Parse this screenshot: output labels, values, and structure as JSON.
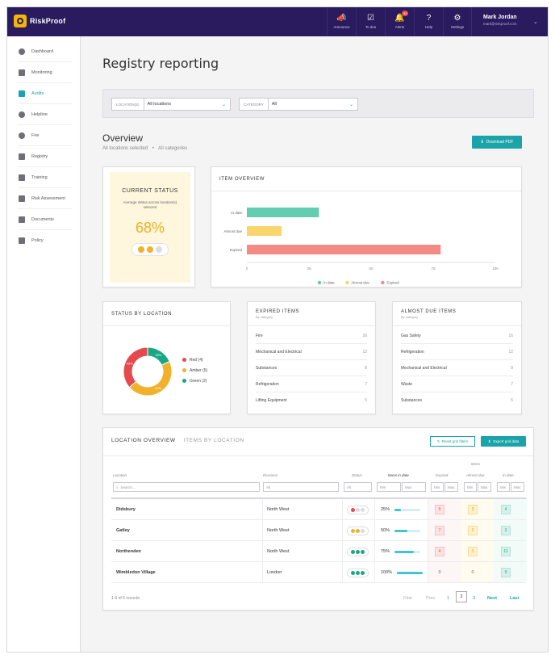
{
  "app": {
    "brand": "RiskProof",
    "colors": {
      "topbar": "#2a1a5e",
      "accent": "#1aa3a8",
      "red": "#e5484d",
      "amber": "#f2b12a",
      "green": "#19a886"
    }
  },
  "topnav": [
    {
      "label": "Announce",
      "icon": "megaphone-icon"
    },
    {
      "label": "To dos",
      "icon": "checkbox-icon"
    },
    {
      "label": "Alerts",
      "icon": "bell-icon",
      "badge": "99"
    },
    {
      "label": "Help",
      "icon": "help-icon"
    },
    {
      "label": "Settings",
      "icon": "gear-icon"
    }
  ],
  "user": {
    "name": "Mark Jordan",
    "email": "mark@riskproof.com"
  },
  "sidebar": [
    {
      "label": "Dashboard"
    },
    {
      "label": "Monitoring"
    },
    {
      "label": "Audits",
      "active": true
    },
    {
      "label": "Helpline"
    },
    {
      "label": "Fire"
    },
    {
      "label": "Registry"
    },
    {
      "label": "Training"
    },
    {
      "label": "Risk Assessment"
    },
    {
      "label": "Documents"
    },
    {
      "label": "Policy"
    }
  ],
  "page": {
    "title": "Registry reporting"
  },
  "filters": {
    "location_tag": "LOCATION(S)",
    "location_value": "All locations",
    "category_tag": "CATEGORY",
    "category_value": "All"
  },
  "overview": {
    "title": "Overview",
    "selected_locations": "All locations selected",
    "separator": "•",
    "selected_categories": "All categories",
    "download_label": "Download PDF"
  },
  "current_status": {
    "title": "CURRENT STATUS",
    "description": "Average status across location(s) selected",
    "percent": "68%",
    "dots": [
      "#f2b12a",
      "#f2b12a",
      "#dcdce0"
    ]
  },
  "item_overview": {
    "title": "ITEM OVERVIEW",
    "chart_data": {
      "type": "bar",
      "orientation": "horizontal",
      "categories": [
        "In date",
        "Almost due",
        "Expired"
      ],
      "values": [
        29,
        14,
        78
      ],
      "colors": [
        "#62cdb0",
        "#f9d56b",
        "#f38a84"
      ],
      "xlim": [
        0,
        100
      ],
      "xticks": [
        "0",
        "25",
        "50",
        "75",
        "100"
      ],
      "legend": [
        "In date",
        "Almost due",
        "Expired"
      ],
      "legend_position": "bottom"
    }
  },
  "status_by_location": {
    "title": "STATUS BY LOCATION",
    "chart_data": {
      "type": "pie",
      "donut": true,
      "labels": [
        "Red",
        "Amber",
        "Green"
      ],
      "values": [
        4,
        5,
        2
      ],
      "slice_labels": [
        "43%",
        "40%",
        "16%"
      ],
      "colors": [
        "#e5484d",
        "#f2b12a",
        "#19a886"
      ],
      "legend_position": "right"
    },
    "legend": [
      "Red (4)",
      "Amber (5)",
      "Green (2)"
    ]
  },
  "expired_items": {
    "title": "EXPIRED ITEMS",
    "subtitle": "By category",
    "rows": [
      {
        "name": "Fire",
        "count": "16"
      },
      {
        "name": "Mechanical and Electrical",
        "count": "12"
      },
      {
        "name": "Substances",
        "count": "8"
      },
      {
        "name": "Refrigeration",
        "count": "7"
      },
      {
        "name": "Lifting Equipment",
        "count": "5"
      }
    ]
  },
  "almost_due_items": {
    "title": "ALMOST DUE ITEMS",
    "subtitle": "By category",
    "rows": [
      {
        "name": "Gas Safety",
        "count": "16"
      },
      {
        "name": "Refrigeration",
        "count": "12"
      },
      {
        "name": "Mechanical and Electrical",
        "count": "8"
      },
      {
        "name": "Waste",
        "count": "7"
      },
      {
        "name": "Substances",
        "count": "5"
      }
    ]
  },
  "location_table": {
    "tab_active": "LOCATION OVERVIEW",
    "tab_inactive": "ITEMS BY LOCATION",
    "reset_label": "Reset grid filters",
    "export_label": "Export grid data",
    "headers": {
      "location": "Location",
      "divisions": "Divisions",
      "status": "Status",
      "in_date_pct": "Items in date",
      "items_group": "Items",
      "expired": "Expired",
      "almost_due": "Almost due",
      "in_date": "In date"
    },
    "filters": {
      "search_placeholder": "Search...",
      "divisions": "All",
      "status": "All",
      "min": "Min",
      "max": "Max"
    },
    "rows": [
      {
        "location": "Didsbury",
        "division": "North West",
        "dots": [
          "#e5484d",
          "#dcdce0",
          "#dcdce0"
        ],
        "pct_label": "25%",
        "pct": 0.25,
        "expired": "9",
        "almost_due": "3",
        "in_date": "4"
      },
      {
        "location": "Gatley",
        "division": "North West",
        "dots": [
          "#f2b12a",
          "#f2b12a",
          "#dcdce0"
        ],
        "pct_label": "50%",
        "pct": 0.5,
        "expired": "7",
        "almost_due": "2",
        "in_date": "3"
      },
      {
        "location": "Northenden",
        "division": "North West",
        "dots": [
          "#19a886",
          "#19a886",
          "#19a886"
        ],
        "pct_label": "75%",
        "pct": 0.75,
        "expired": "4",
        "almost_due": "1",
        "in_date": "11"
      },
      {
        "location": "Wimbledon Village",
        "division": "London",
        "dots": [
          "#19a886",
          "#19a886",
          "#19a886"
        ],
        "pct_label": "100%",
        "pct": 1.0,
        "expired": "0",
        "almost_due": "0",
        "in_date": "9"
      }
    ],
    "records_label": "1-6 of 6 records",
    "pager": {
      "first": "First",
      "prev": "Prev",
      "pages": [
        "1",
        "2",
        "3"
      ],
      "current": "2",
      "next": "Next",
      "last": "Last"
    }
  }
}
